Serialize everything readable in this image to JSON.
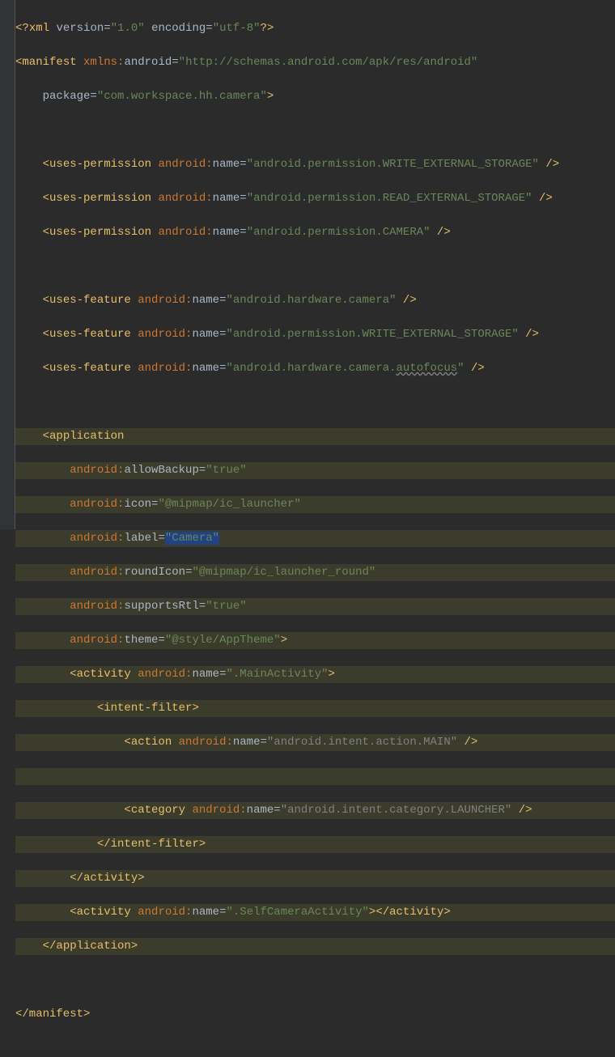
{
  "xml_decl": {
    "prefix": "<?",
    "tag": "xml",
    "attrs": [
      {
        "name": "version",
        "value": "\"1.0\""
      },
      {
        "name": "encoding",
        "value": "\"utf-8\""
      }
    ],
    "suffix": "?>"
  },
  "manifest": {
    "open_lt": "<",
    "tag": "manifest",
    "xmlns_name": "xmlns:android",
    "xmlns_value": "\"http://schemas.android.com/apk/res/android\"",
    "package_name": "package",
    "package_value": "\"com.workspace.hh.camera\"",
    "gt": ">",
    "close": "</manifest>"
  },
  "perm": {
    "tag": "uses-permission",
    "attr_name": "android:name",
    "items": [
      "\"android.permission.WRITE_EXTERNAL_STORAGE\"",
      "\"android.permission.READ_EXTERNAL_STORAGE\"",
      "\"android.permission.CAMERA\""
    ],
    "selfclose": " />"
  },
  "feat": {
    "tag": "uses-feature",
    "attr_name": "android:name",
    "items": [
      "\"android.hardware.camera\"",
      "\"android.permission.WRITE_EXTERNAL_STORAGE\"",
      "\"android.hardware.camera.autofocus\""
    ],
    "autofocus_vis": "autofocus",
    "autofocus_prefix": "\"android.hardware.camera.",
    "autofocus_suffix": "\"",
    "selfclose": " />"
  },
  "app": {
    "tag": "application",
    "attrs": [
      {
        "prefix": "android:",
        "name": "allowBackup",
        "value": "\"true\""
      },
      {
        "prefix": "android:",
        "name": "icon",
        "value": "\"@mipmap/ic_launcher\""
      },
      {
        "prefix": "android:",
        "name": "label",
        "value": "\"Camera\""
      },
      {
        "prefix": "android:",
        "name": "roundIcon",
        "value": "\"@mipmap/ic_launcher_round\""
      },
      {
        "prefix": "android:",
        "name": "supportsRtl",
        "value": "\"true\""
      },
      {
        "prefix": "android:",
        "name": "theme",
        "value": "\"@style/AppTheme\""
      }
    ],
    "gt": ">",
    "close": "</application>"
  },
  "activity": {
    "tag": "activity",
    "attr_name": "android:name",
    "main_value": "\".MainActivity\"",
    "self_value": "\".SelfCameraActivity\"",
    "gt": ">",
    "close": "</activity>"
  },
  "intent": {
    "open": "<intent-filter>",
    "close": "</intent-filter>",
    "action_tag": "action",
    "action_attr": "android:name",
    "action_value": "\"android.intent.action.MAIN\"",
    "category_tag": "category",
    "category_attr": "android:name",
    "category_value": "\"android.intent.category.LAUNCHER\"",
    "selfclose": " />"
  }
}
